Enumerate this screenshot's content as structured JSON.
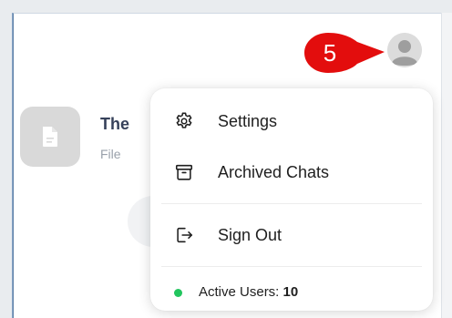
{
  "file": {
    "name": "The",
    "type": "File",
    "icon": "document-icon"
  },
  "annotation": {
    "step": "5",
    "color": "#e30d0d"
  },
  "avatar": {
    "icon": "user-avatar-icon"
  },
  "menu": {
    "items": [
      {
        "label": "Settings",
        "icon": "gear-icon"
      },
      {
        "label": "Archived Chats",
        "icon": "archive-icon"
      },
      {
        "label": "Sign Out",
        "icon": "sign-out-icon"
      }
    ],
    "active_users": {
      "label": "Active Users:",
      "count": "10",
      "status_color": "#22c55e"
    }
  }
}
